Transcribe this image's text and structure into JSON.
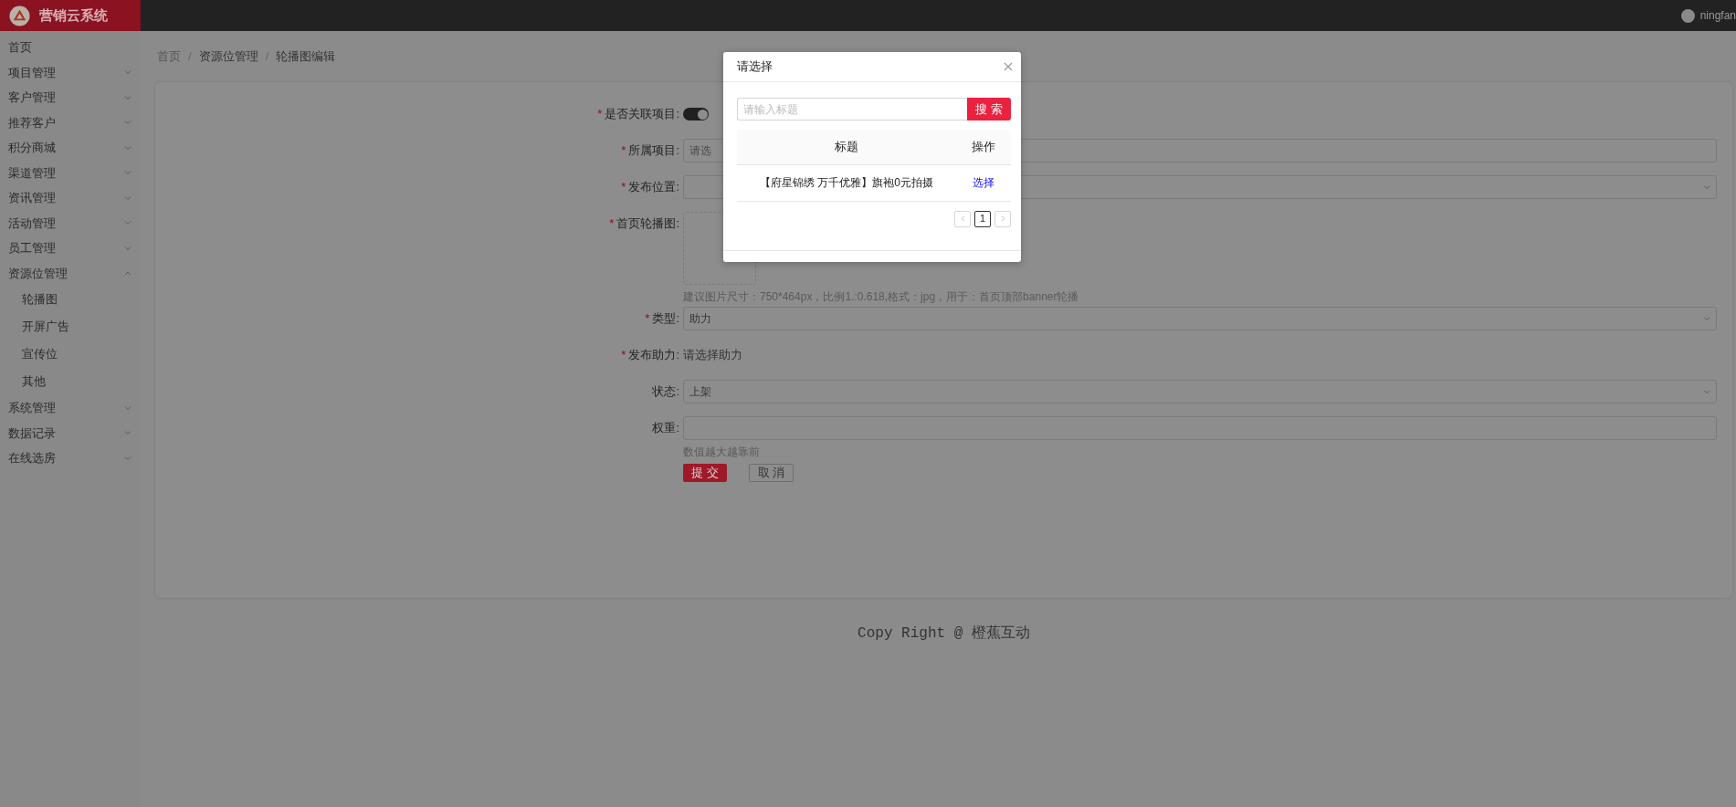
{
  "header": {
    "app_name": "营销云系统",
    "user": "ningfan"
  },
  "sidebar": {
    "items": [
      {
        "kind": "link",
        "label": "首页"
      },
      {
        "kind": "group",
        "label": "项目管理",
        "expanded": false
      },
      {
        "kind": "group",
        "label": "客户管理",
        "expanded": false
      },
      {
        "kind": "group",
        "label": "推荐客户",
        "expanded": false
      },
      {
        "kind": "group",
        "label": "积分商城",
        "expanded": false
      },
      {
        "kind": "group",
        "label": "渠道管理",
        "expanded": false
      },
      {
        "kind": "group",
        "label": "资讯管理",
        "expanded": false
      },
      {
        "kind": "group",
        "label": "活动管理",
        "expanded": false
      },
      {
        "kind": "group",
        "label": "员工管理",
        "expanded": false
      },
      {
        "kind": "group",
        "label": "资源位管理",
        "expanded": true,
        "children": [
          {
            "label": "轮播图"
          },
          {
            "label": "开屏广告"
          },
          {
            "label": "宣传位"
          },
          {
            "label": "其他"
          }
        ]
      },
      {
        "kind": "group",
        "label": "系统管理",
        "expanded": false
      },
      {
        "kind": "group",
        "label": "数据记录",
        "expanded": false
      },
      {
        "kind": "group",
        "label": "在线选房",
        "expanded": false
      }
    ]
  },
  "breadcrumb": [
    {
      "kind": "link",
      "label": "首页"
    },
    {
      "kind": "separator",
      "label": "/"
    },
    {
      "kind": "link",
      "label": "资源位管理"
    },
    {
      "kind": "separator",
      "label": "/"
    },
    {
      "kind": "current",
      "label": "轮播图编辑"
    }
  ],
  "form": {
    "fields": [
      {
        "kind": "switch",
        "required_mark": "*",
        "label": "是否关联项目:",
        "on": true
      },
      {
        "kind": "input",
        "required_mark": "*",
        "label": "所属项目:",
        "placeholder": "请选"
      },
      {
        "kind": "select",
        "required_mark": "*",
        "label": "发布位置:"
      },
      {
        "kind": "upload",
        "required_mark": "*",
        "label": "首页轮播图:",
        "hint": "建议图片尺寸：750*464px，比例1.:0.618,格式：jpg，用于：首页顶部banner轮播"
      },
      {
        "kind": "select",
        "required_mark": "*",
        "label": "类型:",
        "value": "助力"
      },
      {
        "kind": "text",
        "required_mark": "*",
        "label": "发布助力:",
        "value": "请选择助力"
      },
      {
        "kind": "select",
        "label": "状态:",
        "value": "上架"
      },
      {
        "kind": "input",
        "label": "权重:",
        "hint": "数值越大越靠前"
      }
    ],
    "buttons": [
      {
        "kind": "primary",
        "label": "提 交"
      },
      {
        "kind": "default",
        "label": "取 消"
      }
    ]
  },
  "footer": "Copy Right @ 橙蕉互动",
  "modal": {
    "title": "请选择",
    "search_placeholder": "请输入标题",
    "search_button": "搜 索",
    "table": {
      "columns": [
        "标题",
        "操作"
      ],
      "rows": [
        {
          "title": "【府星锦绣 万千优雅】旗袍0元拍摄",
          "action": "选择"
        }
      ]
    },
    "pagination": [
      {
        "label": "1",
        "selected": true
      }
    ]
  }
}
